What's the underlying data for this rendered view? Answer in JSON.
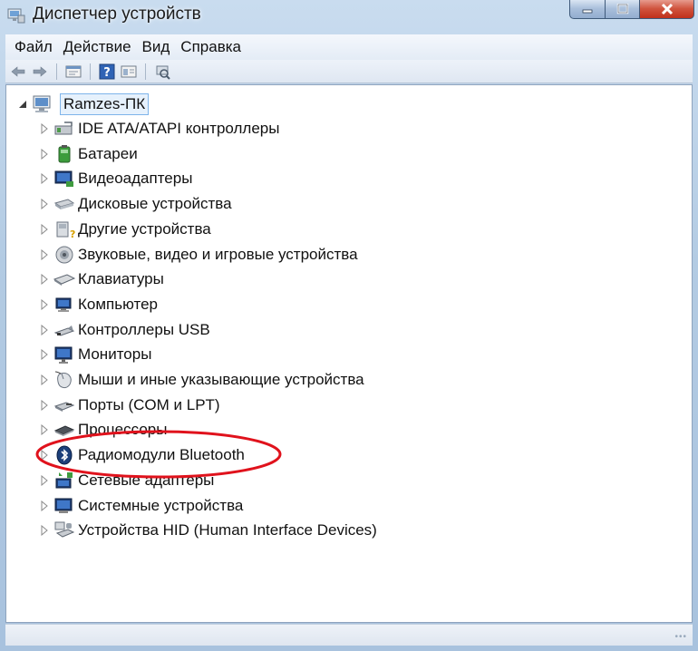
{
  "window": {
    "title": "Диспетчер устройств"
  },
  "menu": {
    "items": [
      "Файл",
      "Действие",
      "Вид",
      "Справка"
    ]
  },
  "toolbar": {
    "buttons": [
      "back-arrow-icon",
      "forward-arrow-icon",
      "properties-icon",
      "help-icon",
      "view-icon",
      "scan-hardware-icon"
    ]
  },
  "tree": {
    "root_label": "Ramzes-ПК",
    "items": [
      {
        "label": "IDE ATA/ATAPI контроллеры",
        "icon": "ide-controller-icon"
      },
      {
        "label": "Батареи",
        "icon": "battery-icon"
      },
      {
        "label": "Видеоадаптеры",
        "icon": "display-adapter-icon"
      },
      {
        "label": "Дисковые устройства",
        "icon": "disk-drive-icon"
      },
      {
        "label": "Другие устройства",
        "icon": "other-devices-icon"
      },
      {
        "label": "Звуковые, видео и игровые устройства",
        "icon": "sound-icon"
      },
      {
        "label": "Клавиатуры",
        "icon": "keyboard-icon"
      },
      {
        "label": "Компьютер",
        "icon": "computer-icon"
      },
      {
        "label": "Контроллеры USB",
        "icon": "usb-icon"
      },
      {
        "label": "Мониторы",
        "icon": "monitor-icon"
      },
      {
        "label": "Мыши и иные указывающие устройства",
        "icon": "mouse-icon"
      },
      {
        "label": "Порты (COM и LPT)",
        "icon": "port-icon"
      },
      {
        "label": "Процессоры",
        "icon": "processor-icon"
      },
      {
        "label": "Радиомодули Bluetooth",
        "icon": "bluetooth-icon"
      },
      {
        "label": "Сетевые адаптеры",
        "icon": "network-adapter-icon"
      },
      {
        "label": "Системные устройства",
        "icon": "system-devices-icon"
      },
      {
        "label": "Устройства HID (Human Interface Devices)",
        "icon": "hid-icon"
      }
    ]
  },
  "colors": {
    "highlight_ellipse": "#e0121c",
    "selection": "#e6f1fc"
  }
}
